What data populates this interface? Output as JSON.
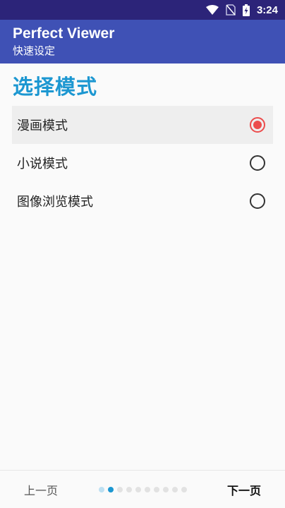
{
  "status_bar": {
    "time": "3:24",
    "icons": [
      "wifi-icon",
      "no-sim-icon",
      "battery-charging-icon"
    ]
  },
  "app_bar": {
    "title": "Perfect Viewer",
    "subtitle": "快速设定"
  },
  "main": {
    "section_title": "选择模式",
    "options": [
      {
        "label": "漫画模式",
        "selected": true
      },
      {
        "label": "小说模式",
        "selected": false
      },
      {
        "label": "图像浏览模式",
        "selected": false
      }
    ]
  },
  "bottom_nav": {
    "prev_label": "上一页",
    "next_label": "下一页",
    "total_pages": 10,
    "current_page": 2
  },
  "colors": {
    "status_bar": "#2c2479",
    "app_bar": "#3f51b5",
    "accent": "#1c97d1",
    "radio_checked": "#ec4c4c"
  }
}
